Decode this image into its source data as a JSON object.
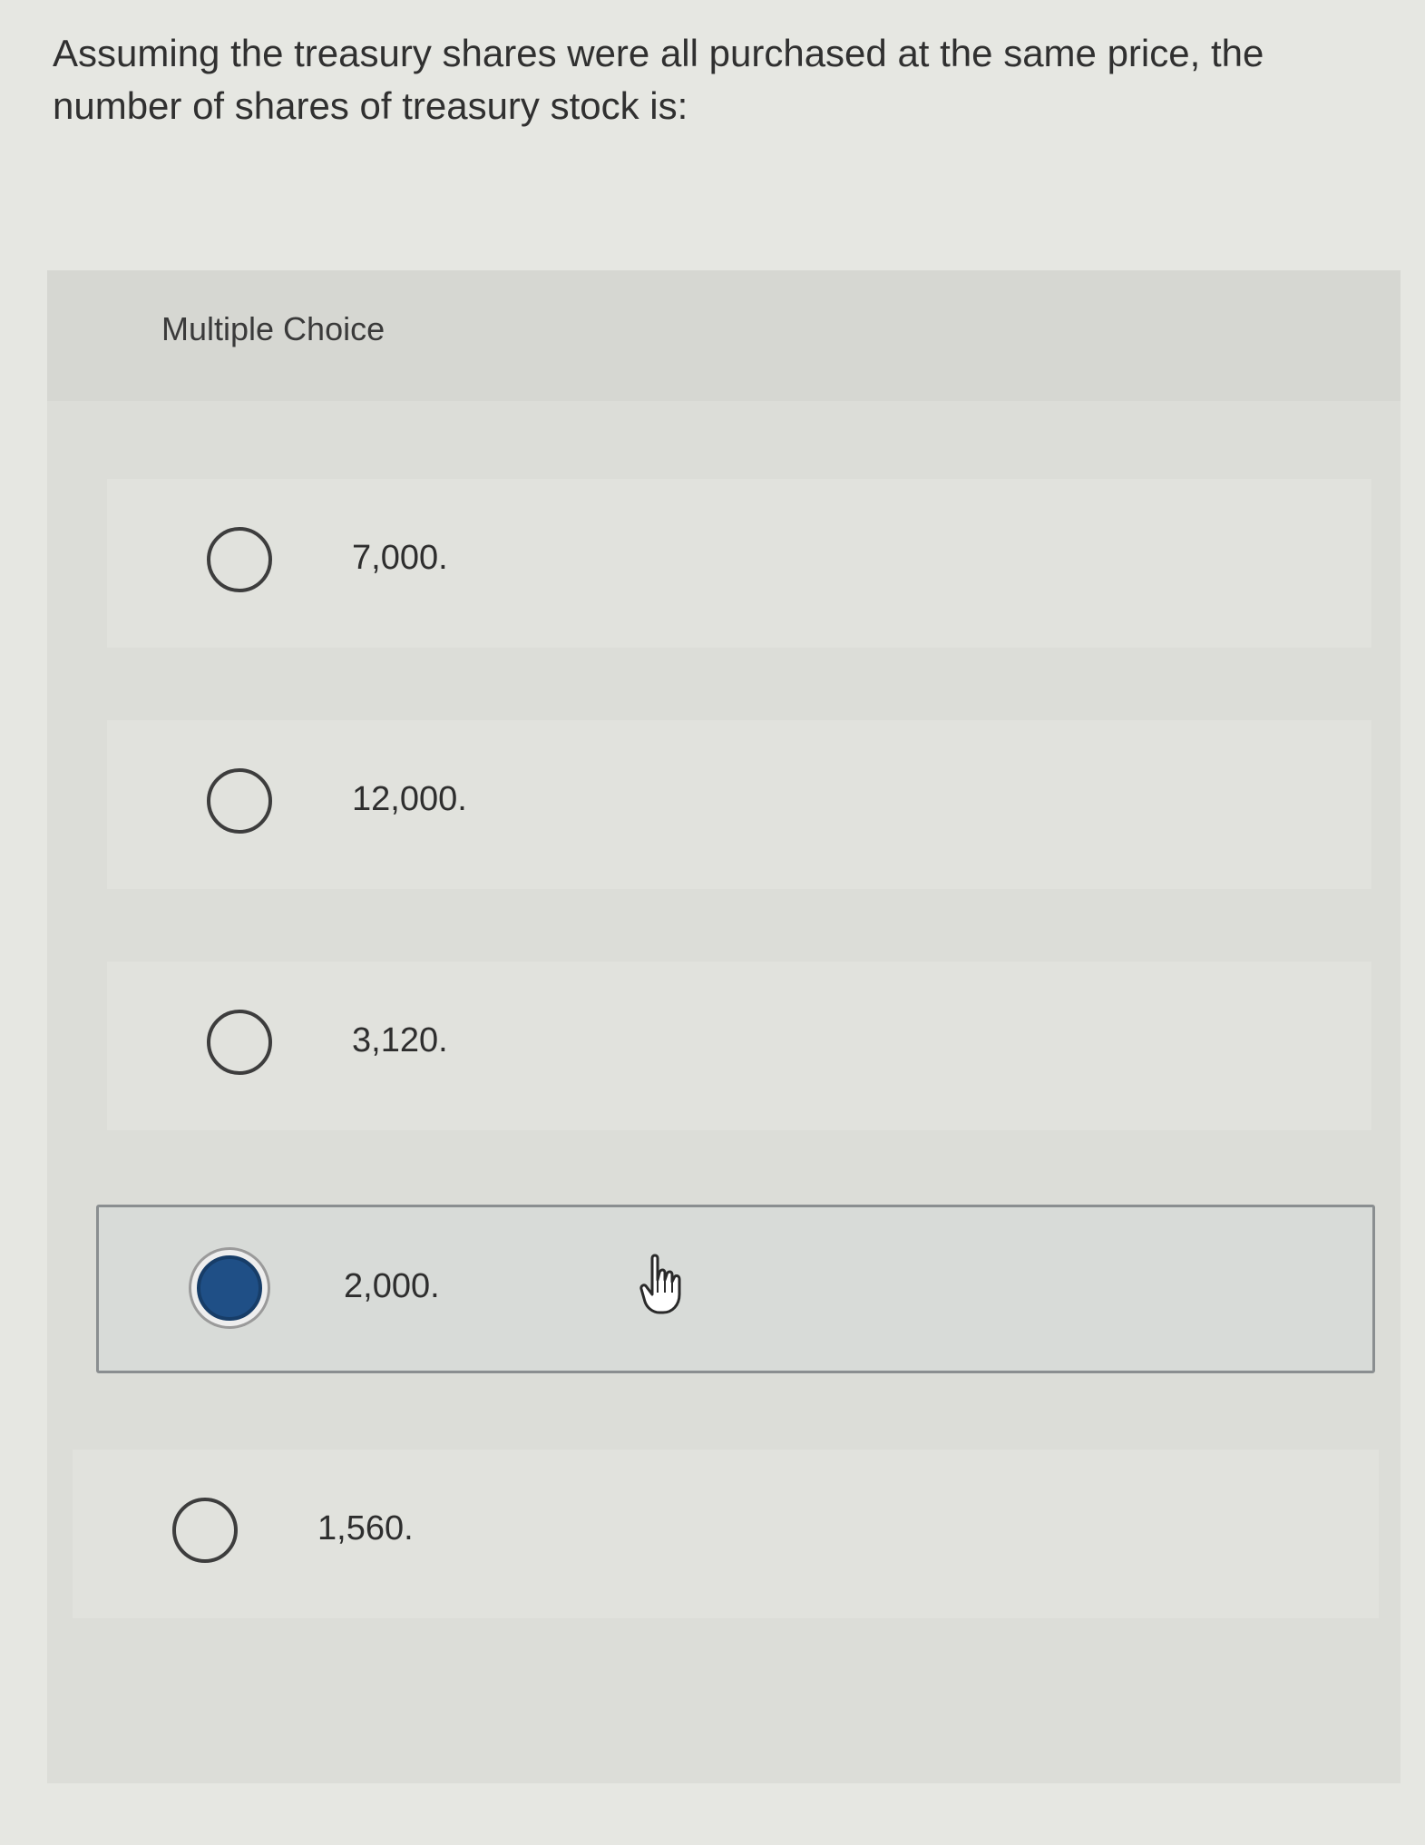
{
  "question": {
    "text": "Assuming the treasury shares were all purchased at the same price, the number of shares of treasury stock is:"
  },
  "multiple_choice": {
    "header": "Multiple Choice",
    "options": [
      {
        "label": "7,000.",
        "selected": false
      },
      {
        "label": "12,000.",
        "selected": false
      },
      {
        "label": "3,120.",
        "selected": false
      },
      {
        "label": "2,000.",
        "selected": true
      },
      {
        "label": "1,560.",
        "selected": false
      }
    ]
  },
  "colors": {
    "selected_radio": "#1f4f86",
    "background": "#e6e7e2"
  },
  "icons": {
    "cursor": "hand-pointer-icon"
  }
}
